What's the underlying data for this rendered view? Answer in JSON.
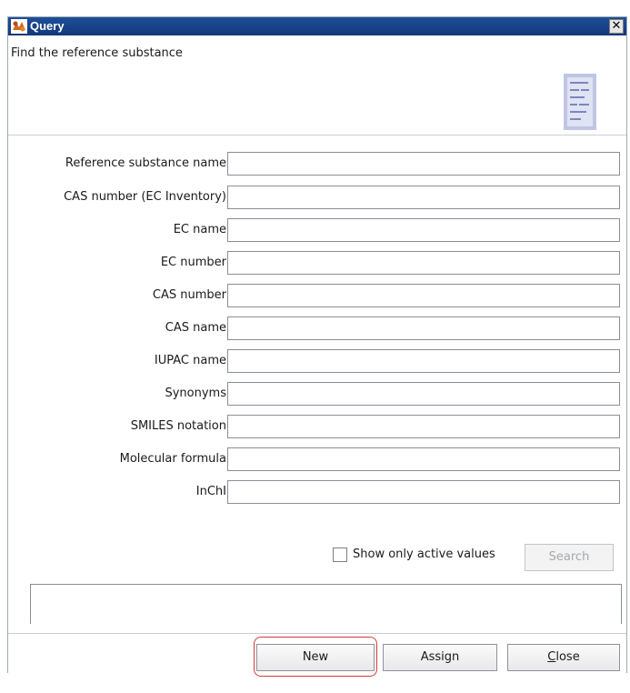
{
  "window": {
    "title": "Query",
    "close_glyph": "✕"
  },
  "header": {
    "description": "Find the reference substance",
    "icon": "document-list-icon"
  },
  "fields": [
    {
      "label": "Reference substance name",
      "value": ""
    },
    {
      "label": "CAS number (EC Inventory)",
      "value": ""
    },
    {
      "label": "EC name",
      "value": ""
    },
    {
      "label": "EC number",
      "value": ""
    },
    {
      "label": "CAS number",
      "value": ""
    },
    {
      "label": "CAS name",
      "value": ""
    },
    {
      "label": "IUPAC name",
      "value": ""
    },
    {
      "label": "Synonyms",
      "value": ""
    },
    {
      "label": "SMILES notation",
      "value": ""
    },
    {
      "label": "Molecular formula",
      "value": ""
    },
    {
      "label": "InChI",
      "value": ""
    }
  ],
  "filter": {
    "show_only_active_label": "Show only active values",
    "checked": false,
    "search_label": "Search"
  },
  "footer": {
    "new_label": "New",
    "assign_label": "Assign",
    "close_mnemonic": "C",
    "close_rest": "lose"
  },
  "colors": {
    "titlebar": "#1f4f9b",
    "highlight": "#d33a3a"
  }
}
